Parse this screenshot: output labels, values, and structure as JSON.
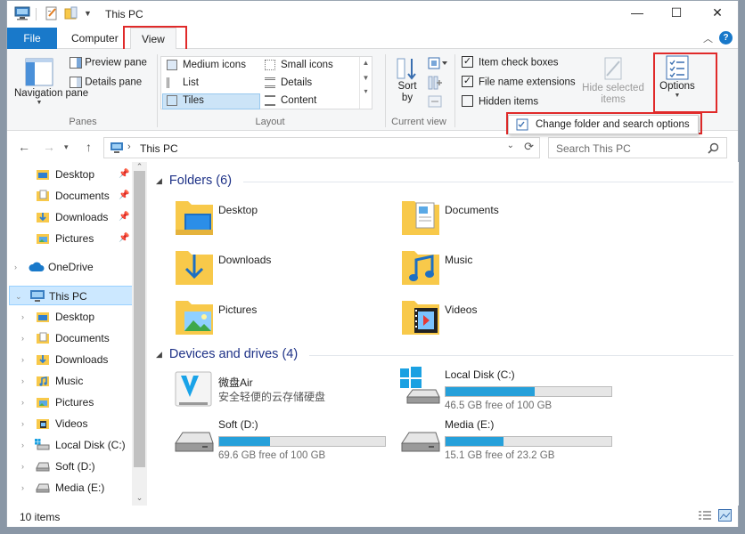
{
  "window": {
    "title": "This PC",
    "minimize_glyph": "—",
    "maximize_glyph": "☐",
    "close_glyph": "✕"
  },
  "ribbon_tabs": {
    "file": "File",
    "computer": "Computer",
    "view": "View",
    "help_glyph": "?"
  },
  "ribbon": {
    "panes": {
      "label": "Panes",
      "navigation_pane": "Navigation pane",
      "preview_pane": "Preview pane",
      "details_pane": "Details pane"
    },
    "layout": {
      "label": "Layout",
      "items": [
        "Medium icons",
        "Small icons",
        "List",
        "Details",
        "Tiles",
        "Content"
      ],
      "selected": "Tiles"
    },
    "current_view": {
      "label": "Current view",
      "sort_by": "Sort by"
    },
    "show_hide": {
      "item_check_boxes": "Item check boxes",
      "file_name_extensions": "File name extensions",
      "hidden_items": "Hidden items",
      "hide_selected_items": "Hide selected items",
      "item_check_boxes_checked": true,
      "file_name_extensions_checked": true,
      "hidden_items_checked": false
    },
    "options": {
      "label": "Options",
      "menu_item": "Change folder and search options"
    }
  },
  "address_bar": {
    "path": "This PC",
    "search_placeholder": "Search This PC"
  },
  "nav_pane": {
    "quick_access": [
      "Desktop",
      "Documents",
      "Downloads",
      "Pictures"
    ],
    "onedrive": "OneDrive",
    "this_pc": "This PC",
    "this_pc_children": [
      "Desktop",
      "Documents",
      "Downloads",
      "Music",
      "Pictures",
      "Videos",
      "Local Disk (C:)",
      "Soft (D:)",
      "Media (E:)"
    ]
  },
  "content": {
    "folders_header": "Folders (6)",
    "folders": [
      "Desktop",
      "Documents",
      "Downloads",
      "Music",
      "Pictures",
      "Videos"
    ],
    "devices_header": "Devices and drives (4)",
    "devices": [
      {
        "name": "微盘Air",
        "sub": "安全轻便的云存储硬盘"
      },
      {
        "name": "Local Disk (C:)",
        "free": "46.5 GB free of 100 GB",
        "used_fraction": 0.535
      },
      {
        "name": "Soft (D:)",
        "free": "69.6 GB free of 100 GB",
        "used_fraction": 0.304
      },
      {
        "name": "Media (E:)",
        "free": "15.1 GB free of 23.2 GB",
        "used_fraction": 0.349
      }
    ]
  },
  "status_bar": {
    "item_count": "10 items"
  },
  "colors": {
    "accent": "#1979ca",
    "highlight_red": "#e02a2a",
    "drive_bar": "#26a0da",
    "folder_yellow": "#f8c94a"
  }
}
